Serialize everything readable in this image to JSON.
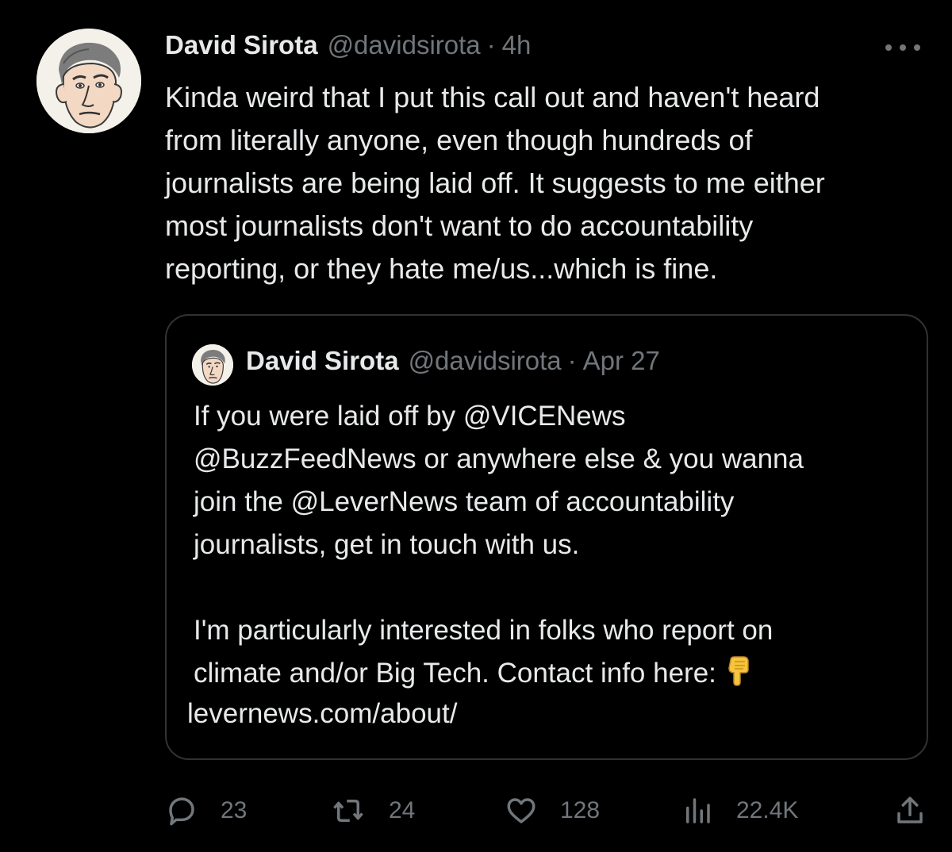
{
  "tweet": {
    "author_name": "David Sirota",
    "handle": "@davidsirota",
    "separator": "·",
    "time": "4h",
    "text": "Kinda weird that I put this call out and haven't heard\nfrom literally anyone, even though hundreds of\njournalists are being laid off. It suggests to me either\nmost journalists don't want to do accountability\nreporting, or they hate me/us...which is fine."
  },
  "quoted": {
    "author_name": "David Sirota",
    "handle": "@davidsirota",
    "separator": "·",
    "time": "Apr 27",
    "text": "If you were laid off by @VICENews\n@BuzzFeedNews or anywhere else & you wanna\njoin the @LeverNews team of accountability\njournalists, get in touch with us.\n\nI'm particularly interested in folks who report on\nclimate and/or Big Tech. Contact info here:",
    "link_text": "levernews.com/about/",
    "emoji": "backhand-index-pointing-down"
  },
  "actions": {
    "replies": "23",
    "reposts": "24",
    "likes": "128",
    "views": "22.4K"
  },
  "icons": {
    "more": "more-horizontal-icon",
    "reply": "reply-bubble-icon",
    "repost": "repost-icon",
    "like": "heart-icon",
    "views": "views-chart-icon",
    "share": "share-icon"
  },
  "colors": {
    "background": "#000000",
    "text": "#e7e9ea",
    "secondary_text": "#71767b",
    "border": "#2f3336"
  }
}
